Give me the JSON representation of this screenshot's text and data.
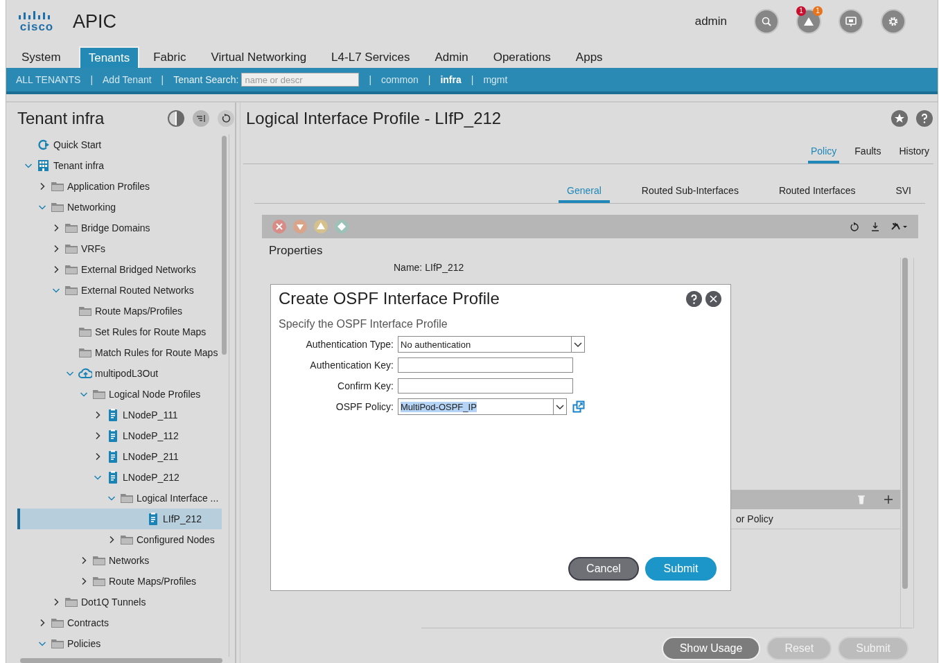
{
  "header": {
    "logo_text": "cisco",
    "app_name": "APIC",
    "user": "admin",
    "alert_badges": [
      {
        "count": "1",
        "color": "#c8102e"
      },
      {
        "count": "1",
        "color": "#e8731a"
      }
    ]
  },
  "menu_tabs": [
    {
      "label": "System",
      "selected": false
    },
    {
      "label": "Tenants",
      "selected": true
    },
    {
      "label": "Fabric",
      "selected": false
    },
    {
      "label": "Virtual Networking",
      "selected": false
    },
    {
      "label": "L4-L7 Services",
      "selected": false
    },
    {
      "label": "Admin",
      "selected": false
    },
    {
      "label": "Operations",
      "selected": false
    },
    {
      "label": "Apps",
      "selected": false
    }
  ],
  "sub_bar": [
    {
      "kind": "link",
      "text": "ALL TENANTS",
      "selected": false
    },
    {
      "kind": "separator",
      "text": "|"
    },
    {
      "kind": "link",
      "text": "Add Tenant",
      "selected": false
    },
    {
      "kind": "separator",
      "text": "|"
    },
    {
      "kind": "label",
      "text": "Tenant Search:"
    },
    {
      "kind": "search",
      "placeholder": "name or descr"
    },
    {
      "kind": "separator",
      "text": "|"
    },
    {
      "kind": "link",
      "text": "common",
      "selected": false
    },
    {
      "kind": "separator",
      "text": "|"
    },
    {
      "kind": "link",
      "text": "infra",
      "selected": true
    },
    {
      "kind": "separator",
      "text": "|"
    },
    {
      "kind": "link",
      "text": "mgmt",
      "selected": false
    }
  ],
  "sidebar": {
    "title": "Tenant infra",
    "tree": [
      {
        "label": "Quick Start",
        "kind": "quickstart",
        "selected": false
      },
      {
        "label": "Tenant infra",
        "kind": "tenant",
        "expanded": true,
        "selected": false,
        "children": [
          {
            "label": "Application Profiles",
            "kind": "folder",
            "expanded": false,
            "selected": false
          },
          {
            "label": "Networking",
            "kind": "folder",
            "expanded": true,
            "selected": false,
            "children": [
              {
                "label": "Bridge Domains",
                "kind": "folder",
                "expanded": false,
                "selected": false
              },
              {
                "label": "VRFs",
                "kind": "folder",
                "expanded": false,
                "selected": false
              },
              {
                "label": "External Bridged Networks",
                "kind": "folder",
                "expanded": false,
                "selected": false
              },
              {
                "label": "External Routed Networks",
                "kind": "folder",
                "expanded": true,
                "selected": false,
                "children": [
                  {
                    "label": "Route Maps/Profiles",
                    "kind": "folder",
                    "selected": false
                  },
                  {
                    "label": "Set Rules for Route Maps",
                    "kind": "folder",
                    "selected": false
                  },
                  {
                    "label": "Match Rules for Route Maps",
                    "kind": "folder",
                    "selected": false
                  },
                  {
                    "label": "multipodL3Out",
                    "kind": "cloud",
                    "expanded": true,
                    "selected": false,
                    "children": [
                      {
                        "label": "Logical Node Profiles",
                        "kind": "folder",
                        "expanded": true,
                        "selected": false,
                        "children": [
                          {
                            "label": "LNodeP_111",
                            "kind": "profile",
                            "expanded": false,
                            "selected": false
                          },
                          {
                            "label": "LNodeP_112",
                            "kind": "profile",
                            "expanded": false,
                            "selected": false
                          },
                          {
                            "label": "LNodeP_211",
                            "kind": "profile",
                            "expanded": false,
                            "selected": false
                          },
                          {
                            "label": "LNodeP_212",
                            "kind": "profile",
                            "expanded": true,
                            "selected": false,
                            "children": [
                              {
                                "label": "Logical Interface ...",
                                "kind": "folder",
                                "expanded": true,
                                "selected": false,
                                "children": [
                                  {
                                    "label": "LIfP_212",
                                    "kind": "profile",
                                    "selected": true
                                  }
                                ]
                              },
                              {
                                "label": "Configured Nodes",
                                "kind": "folder",
                                "expanded": false,
                                "selected": false
                              }
                            ]
                          }
                        ]
                      },
                      {
                        "label": "Networks",
                        "kind": "folder",
                        "expanded": false,
                        "selected": false
                      },
                      {
                        "label": "Route Maps/Profiles",
                        "kind": "folder",
                        "expanded": false,
                        "selected": false
                      }
                    ]
                  }
                ]
              },
              {
                "label": "Dot1Q Tunnels",
                "kind": "folder",
                "expanded": false,
                "selected": false
              }
            ]
          },
          {
            "label": "Contracts",
            "kind": "folder",
            "expanded": false,
            "selected": false
          },
          {
            "label": "Policies",
            "kind": "folder",
            "expanded": true,
            "selected": false
          }
        ]
      }
    ]
  },
  "content": {
    "title": "Logical Interface Profile - LIfP_212",
    "tabs": [
      {
        "label": "Policy",
        "selected": true
      },
      {
        "label": "Faults",
        "selected": false
      },
      {
        "label": "History",
        "selected": false
      }
    ],
    "sub_tabs": [
      {
        "label": "General",
        "selected": true
      },
      {
        "label": "Routed Sub-Interfaces",
        "selected": false
      },
      {
        "label": "Routed Interfaces",
        "selected": false
      },
      {
        "label": "SVI",
        "selected": false
      }
    ],
    "section_title": "Properties",
    "name_label": "Name:",
    "name_value": "LIfP_212",
    "table_row_text": "or Policy",
    "buttons": [
      {
        "label": "Show Usage",
        "disabled": false
      },
      {
        "label": "Reset",
        "disabled": true
      },
      {
        "label": "Submit",
        "disabled": true
      }
    ]
  },
  "dialog": {
    "title": "Create OSPF Interface Profile",
    "subtitle": "Specify the OSPF Interface Profile",
    "fields": [
      {
        "kind": "select",
        "label": "Authentication Type:",
        "value": "No authentication"
      },
      {
        "kind": "input",
        "label": "Authentication Key:"
      },
      {
        "kind": "input",
        "label": "Confirm Key:"
      },
      {
        "kind": "combo",
        "label": "OSPF Policy:",
        "value": "MultiPod-OSPF_IP"
      }
    ],
    "buttons": [
      {
        "label": "Cancel",
        "kind": "secondary"
      },
      {
        "label": "Submit",
        "kind": "primary"
      }
    ]
  }
}
